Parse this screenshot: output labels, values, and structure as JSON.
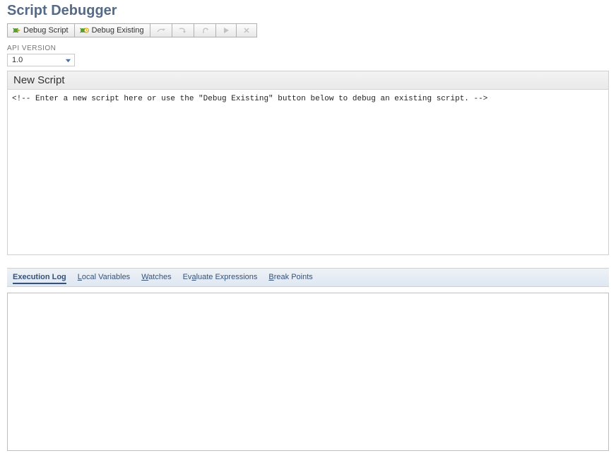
{
  "title": "Script Debugger",
  "toolbar": {
    "debug_script_label": "Debug Script",
    "debug_existing_label": "Debug Existing"
  },
  "api_version": {
    "label": "API VERSION",
    "value": "1.0"
  },
  "editor": {
    "panel_title": "New Script",
    "content": "<!-- Enter a new script here or use the \"Debug Existing\" button below to debug an existing script. -->"
  },
  "tabs": {
    "execution_log": "Execution Log",
    "local_variables_prefix": "L",
    "local_variables_rest": "ocal Variables",
    "watches_prefix": "W",
    "watches_rest": "atches",
    "evaluate_prefix": "Ev",
    "evaluate_accel": "a",
    "evaluate_rest": "luate Expressions",
    "break_points_prefix": "B",
    "break_points_rest": "reak Points"
  }
}
